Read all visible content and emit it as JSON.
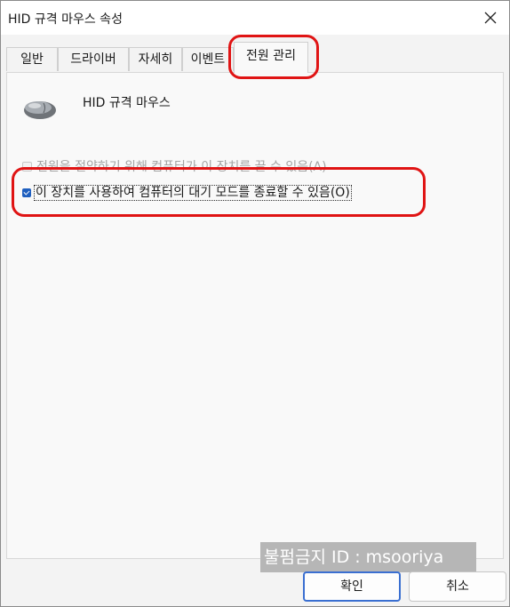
{
  "window": {
    "title": "HID 규격 마우스 속성"
  },
  "tabs": [
    {
      "label": "일반"
    },
    {
      "label": "드라이버"
    },
    {
      "label": "자세히"
    },
    {
      "label": "이벤트"
    },
    {
      "label": "전원 관리"
    }
  ],
  "device": {
    "name": "HID 규격 마우스",
    "icon": "mouse-icon"
  },
  "power": {
    "allow_turn_off_label": "전원을 절약하기 위해 컴퓨터가 이 장치를 끌 수 있음(A)",
    "allow_turn_off_checked": false,
    "allow_wake_label": "이 장치를 사용하여 컴퓨터의 대기 모드를 종료할 수 있음(O)",
    "allow_wake_checked": true
  },
  "watermark": "불펌금지 ID : msooriya",
  "buttons": {
    "ok": "확인",
    "cancel": "취소"
  },
  "colors": {
    "annotation": "#e01414",
    "checkbox": "#1f5fbf"
  }
}
